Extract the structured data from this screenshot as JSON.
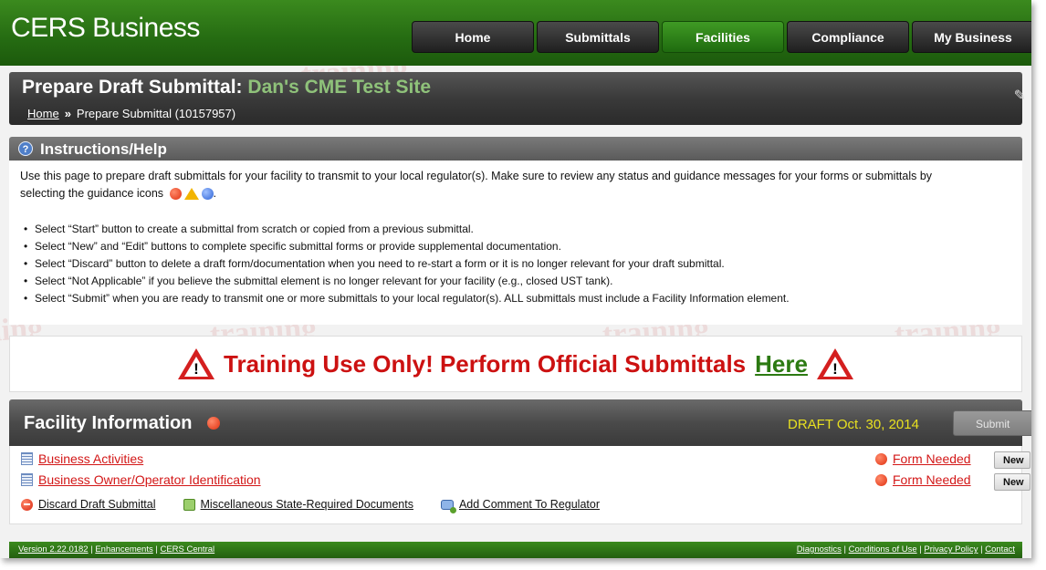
{
  "app": {
    "brand": "CERS Business"
  },
  "nav": [
    {
      "label": "Home",
      "active": false
    },
    {
      "label": "Submittals",
      "active": false
    },
    {
      "label": "Facilities",
      "active": true
    },
    {
      "label": "Compliance",
      "active": false
    },
    {
      "label": "My Business",
      "active": false
    }
  ],
  "page": {
    "title_prefix": "Prepare Draft Submittal:",
    "site_name": "Dan's CME Test Site",
    "breadcrumb_home": "Home",
    "breadcrumb_sep": "»",
    "breadcrumb_current": "Prepare Submittal (10157957)"
  },
  "instructions": {
    "title": "Instructions/Help",
    "intro_a": "Use this page to prepare draft submittals for your facility to transmit to your local regulator(s). Make sure to review any status and guidance messages for your forms or submittals by",
    "intro_b": "selecting the guidance icons",
    "intro_end": ".",
    "bullets": [
      "Select “Start” button to create a submittal from scratch or copied from a previous submittal.",
      "Select “New” and “Edit” buttons to complete specific submittal forms or provide supplemental documentation.",
      "Select “Discard” button to delete a draft form/documentation when you need to re-start a form or it is no longer relevant for your draft submittal.",
      "Select “Not Applicable” if you believe the submittal element is no longer relevant for your facility (e.g., closed UST tank).",
      "Select “Submit” when you are ready to transmit one or more submittals to your local regulator(s). ALL submittals must include a Facility Information element."
    ]
  },
  "banner": {
    "text": "Training Use Only! Perform Official Submittals",
    "link": "Here",
    "color": "#cc1111",
    "link_color": "#2c7a12"
  },
  "facility": {
    "title": "Facility Information",
    "draft_date": "DRAFT Oct. 30, 2014",
    "submit_label": "Submit",
    "forms": [
      {
        "name": "Business Activities",
        "status": "Form Needed",
        "button": "New"
      },
      {
        "name": "Business Owner/Operator Identification",
        "status": "Form Needed",
        "button": "New"
      }
    ],
    "actions": {
      "discard": "Discard Draft Submittal",
      "misc": "Miscellaneous State-Required Documents",
      "comment": "Add Comment To Regulator"
    }
  },
  "footer": {
    "version": "Version 2.22.0182",
    "enhancements": "Enhancements",
    "central": "CERS Central",
    "diagnostics": "Diagnostics",
    "conditions": "Conditions of Use",
    "privacy": "Privacy Policy",
    "contact": "Contact",
    "sep": " | "
  },
  "watermark": "training",
  "colors": {
    "header_green": "#256b12",
    "accent_yellow": "#e8e020",
    "link_red": "#d31717"
  }
}
